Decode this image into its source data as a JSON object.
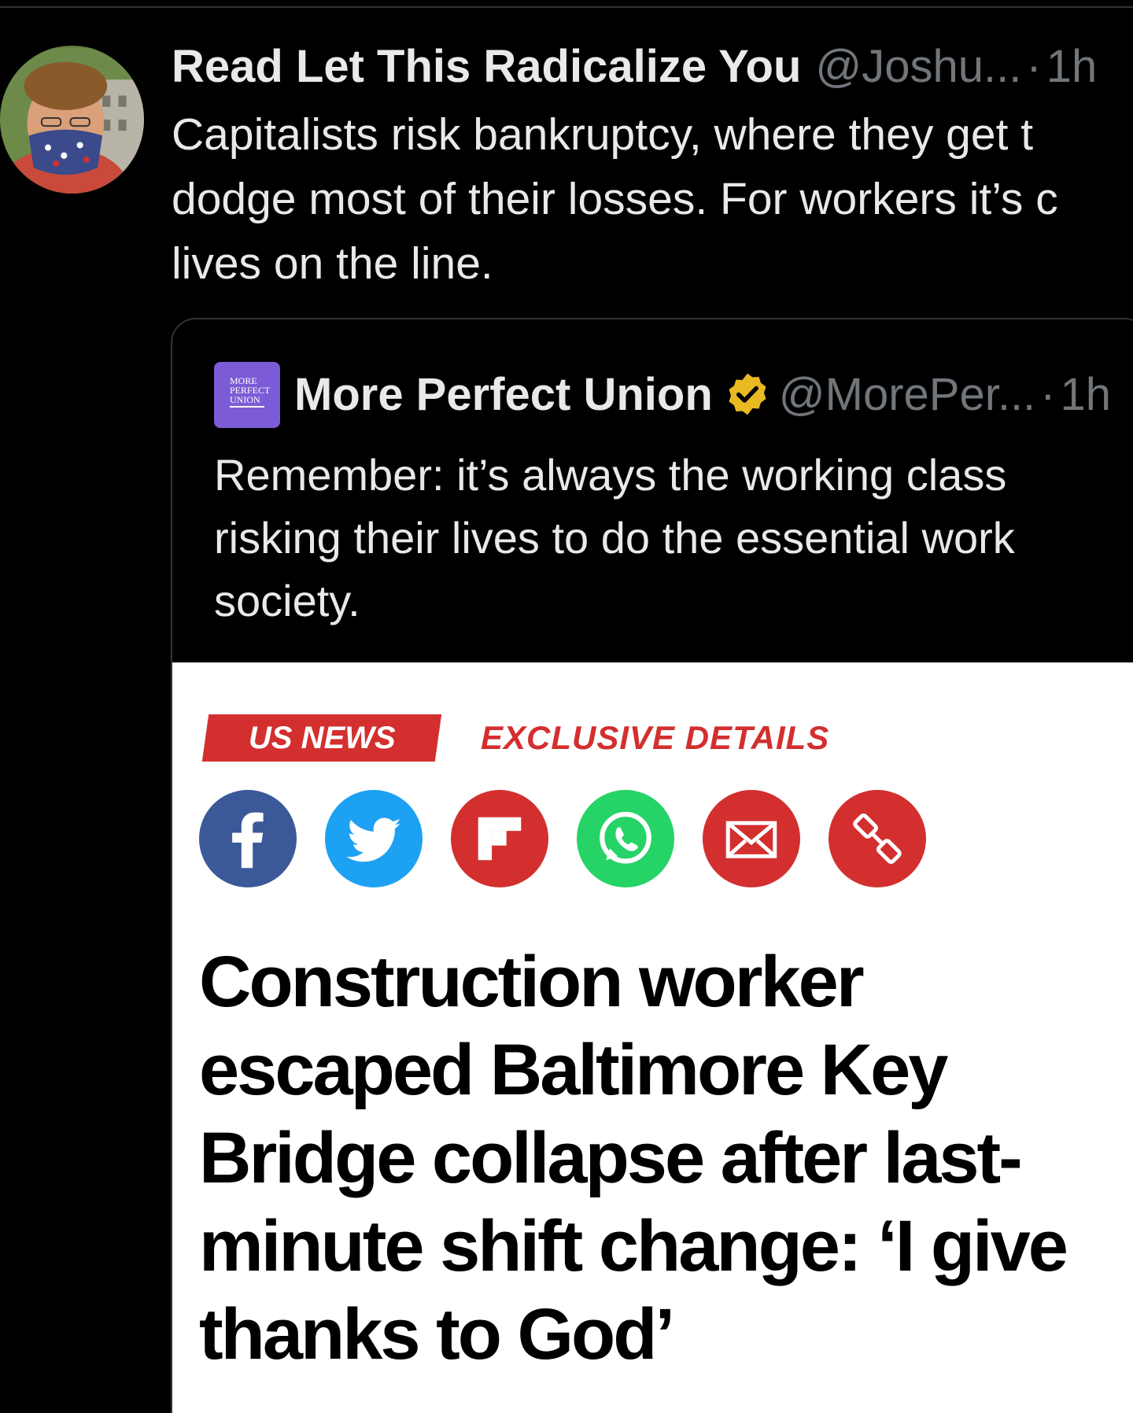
{
  "tweet": {
    "display_name": "Read Let This Radicalize You",
    "handle": "@Joshu...",
    "separator": "·",
    "time": "1h",
    "text_lines": [
      "Capitalists risk bankruptcy, where they get t",
      "dodge most of their losses. For workers it’s c",
      "lives on the line."
    ]
  },
  "quote": {
    "logo_text": [
      "MORE",
      "PERFECT",
      "UNION"
    ],
    "display_name": "More Perfect Union",
    "handle": "@MorePer...",
    "separator": "·",
    "time": "1h",
    "text_lines": [
      "Remember: it’s always the working class",
      "risking their lives to do the essential work",
      "society."
    ]
  },
  "article": {
    "category_badge": "US NEWS",
    "tag": "EXCLUSIVE DETAILS",
    "share_icons": [
      "facebook-icon",
      "twitter-icon",
      "flipboard-icon",
      "whatsapp-icon",
      "email-icon",
      "link-icon"
    ],
    "headline_lines": [
      "Construction worker",
      "escaped Baltimore Key",
      "Bridge collapse after last-",
      "minute shift change: ‘I give",
      "thanks to God’"
    ]
  },
  "colors": {
    "background": "#000000",
    "primary_text": "#e7e9ea",
    "secondary_text": "#71767b",
    "border": "#2f3336",
    "news_red": "#d32f2f",
    "facebook": "#3b5998",
    "twitter": "#1da1f2",
    "whatsapp": "#25d366",
    "verified_gold": "#e8b923",
    "mpu_purple": "#7b5cd6"
  }
}
